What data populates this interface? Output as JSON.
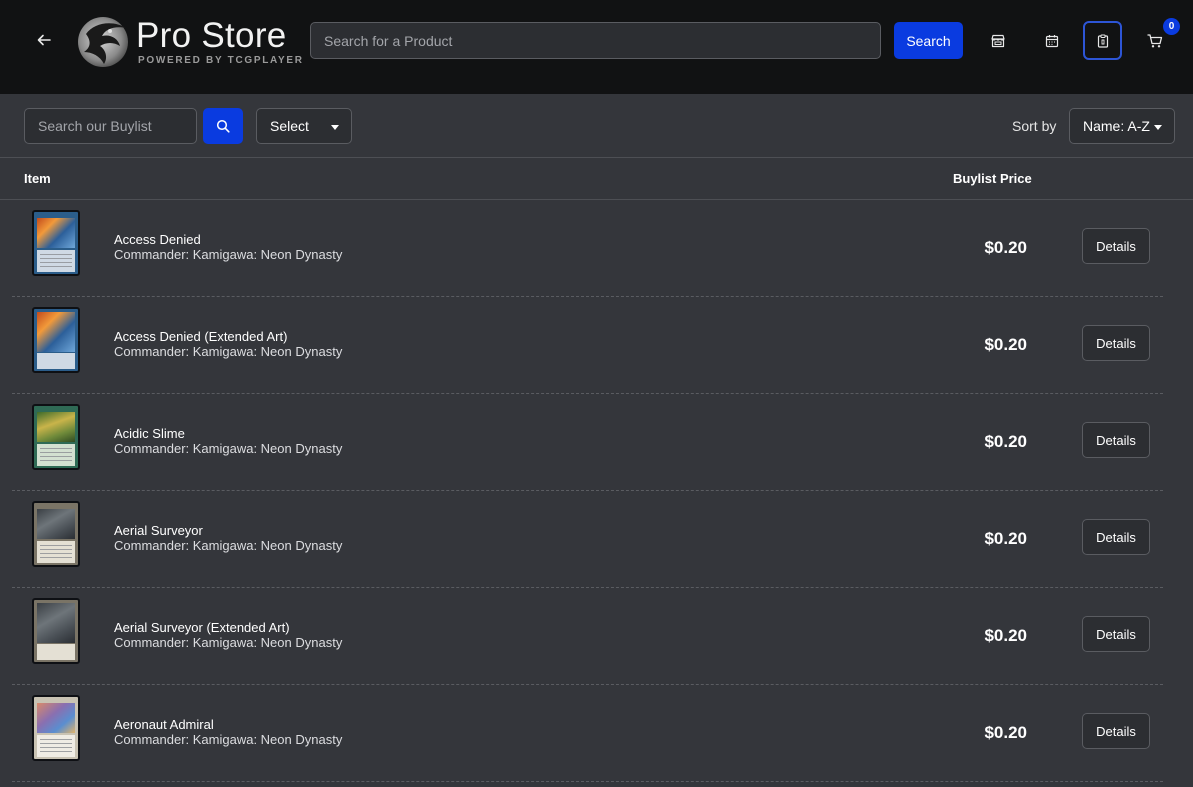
{
  "header": {
    "logo_title": "Pro Store",
    "logo_subtitle": "POWERED BY TCGPLAYER",
    "search_placeholder": "Search for a Product",
    "search_button": "Search",
    "cart_count": "0",
    "icons": [
      "back-arrow-icon",
      "store-icon",
      "calendar-icon",
      "clipboard-icon",
      "cart-icon"
    ]
  },
  "filters": {
    "buylist_search_placeholder": "Search our Buylist",
    "select_label": "Select",
    "sort_label": "Sort by",
    "sort_value": "Name: A-Z"
  },
  "table": {
    "columns": {
      "item": "Item",
      "price": "Buylist Price"
    },
    "details_label": "Details",
    "rows": [
      {
        "name": "Access Denied",
        "set": "Commander: Kamigawa: Neon Dynasty",
        "price": "$0.20"
      },
      {
        "name": "Access Denied (Extended Art)",
        "set": "Commander: Kamigawa: Neon Dynasty",
        "price": "$0.20"
      },
      {
        "name": "Acidic Slime",
        "set": "Commander: Kamigawa: Neon Dynasty",
        "price": "$0.20"
      },
      {
        "name": "Aerial Surveyor",
        "set": "Commander: Kamigawa: Neon Dynasty",
        "price": "$0.20"
      },
      {
        "name": "Aerial Surveyor (Extended Art)",
        "set": "Commander: Kamigawa: Neon Dynasty",
        "price": "$0.20"
      },
      {
        "name": "Aeronaut Admiral",
        "set": "Commander: Kamigawa: Neon Dynasty",
        "price": "$0.20"
      }
    ]
  },
  "colors": {
    "accent": "#0a3be0",
    "header_bg": "#111213",
    "page_bg": "#34363b"
  }
}
